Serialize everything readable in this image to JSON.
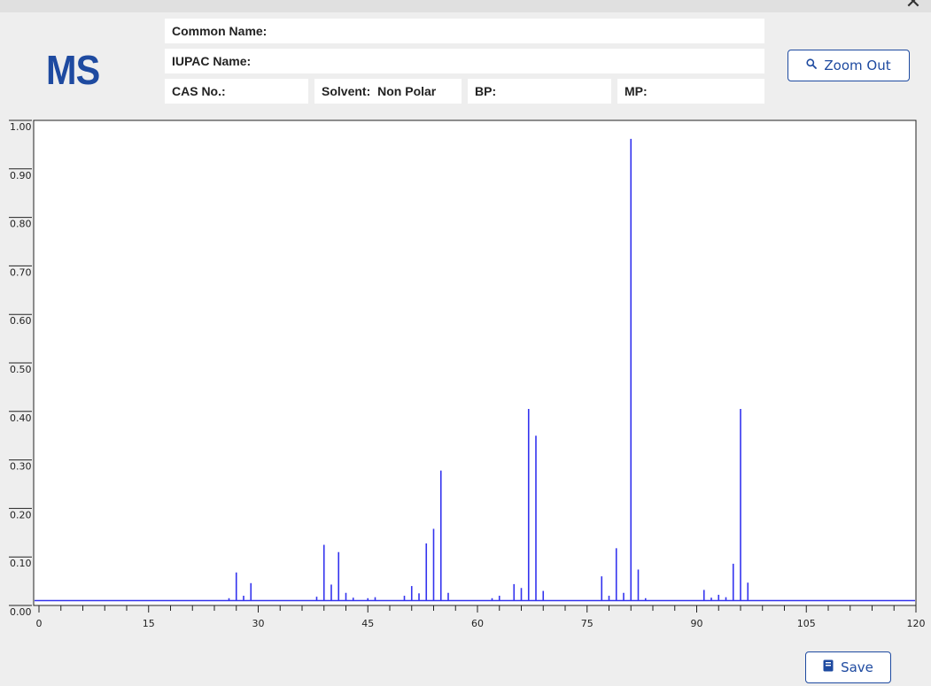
{
  "window": {
    "close_label": "✕"
  },
  "logo": {
    "text": "MS"
  },
  "info": {
    "common_name_label": "Common Name:",
    "common_name_value": "",
    "iupac_name_label": "IUPAC Name:",
    "iupac_name_value": "",
    "cas_label": "CAS No.:",
    "cas_value": "",
    "solvent_label": "Solvent:",
    "solvent_value": "Non Polar",
    "bp_label": "BP:",
    "bp_value": "",
    "mp_label": "MP:",
    "mp_value": ""
  },
  "buttons": {
    "zoom_out_label": "Zoom Out",
    "zoom_out_icon": "magnifier-icon",
    "save_label": "Save",
    "save_icon": "save-icon"
  },
  "colors": {
    "accent": "#1e4aa0",
    "spectrum": "#3333ee",
    "background": "#eeeeee"
  },
  "chart_data": {
    "type": "bar",
    "title": "",
    "xlabel": "",
    "ylabel": "",
    "xlim": [
      0,
      120
    ],
    "ylim": [
      0,
      1.0
    ],
    "x_ticks": [
      "0",
      "15",
      "30",
      "45",
      "60",
      "75",
      "90",
      "105",
      "120"
    ],
    "y_ticks": [
      "0.00",
      "0.10",
      "0.20",
      "0.30",
      "0.40",
      "0.50",
      "0.60",
      "0.70",
      "0.80",
      "0.90",
      "1.00"
    ],
    "baseline": 0.01,
    "grid": false,
    "legend": "none",
    "series": [
      {
        "peaks": [
          {
            "x": 26,
            "y": 0.015
          },
          {
            "x": 27,
            "y": 0.068
          },
          {
            "x": 28,
            "y": 0.02
          },
          {
            "x": 29,
            "y": 0.046
          },
          {
            "x": 38,
            "y": 0.018
          },
          {
            "x": 39,
            "y": 0.125
          },
          {
            "x": 40,
            "y": 0.043
          },
          {
            "x": 41,
            "y": 0.11
          },
          {
            "x": 42,
            "y": 0.026
          },
          {
            "x": 43,
            "y": 0.016
          },
          {
            "x": 45,
            "y": 0.015
          },
          {
            "x": 46,
            "y": 0.017
          },
          {
            "x": 50,
            "y": 0.02
          },
          {
            "x": 51,
            "y": 0.04
          },
          {
            "x": 52,
            "y": 0.025
          },
          {
            "x": 53,
            "y": 0.128
          },
          {
            "x": 54,
            "y": 0.158
          },
          {
            "x": 55,
            "y": 0.278
          },
          {
            "x": 56,
            "y": 0.026
          },
          {
            "x": 62,
            "y": 0.015
          },
          {
            "x": 63,
            "y": 0.02
          },
          {
            "x": 65,
            "y": 0.044
          },
          {
            "x": 66,
            "y": 0.036
          },
          {
            "x": 67,
            "y": 0.405
          },
          {
            "x": 68,
            "y": 0.35
          },
          {
            "x": 69,
            "y": 0.03
          },
          {
            "x": 77,
            "y": 0.06
          },
          {
            "x": 78,
            "y": 0.02
          },
          {
            "x": 79,
            "y": 0.118
          },
          {
            "x": 80,
            "y": 0.026
          },
          {
            "x": 81,
            "y": 0.962
          },
          {
            "x": 82,
            "y": 0.074
          },
          {
            "x": 83,
            "y": 0.015
          },
          {
            "x": 91,
            "y": 0.032
          },
          {
            "x": 92,
            "y": 0.016
          },
          {
            "x": 93,
            "y": 0.022
          },
          {
            "x": 94,
            "y": 0.017
          },
          {
            "x": 95,
            "y": 0.086
          },
          {
            "x": 96,
            "y": 0.405
          },
          {
            "x": 97,
            "y": 0.047
          }
        ]
      }
    ]
  }
}
